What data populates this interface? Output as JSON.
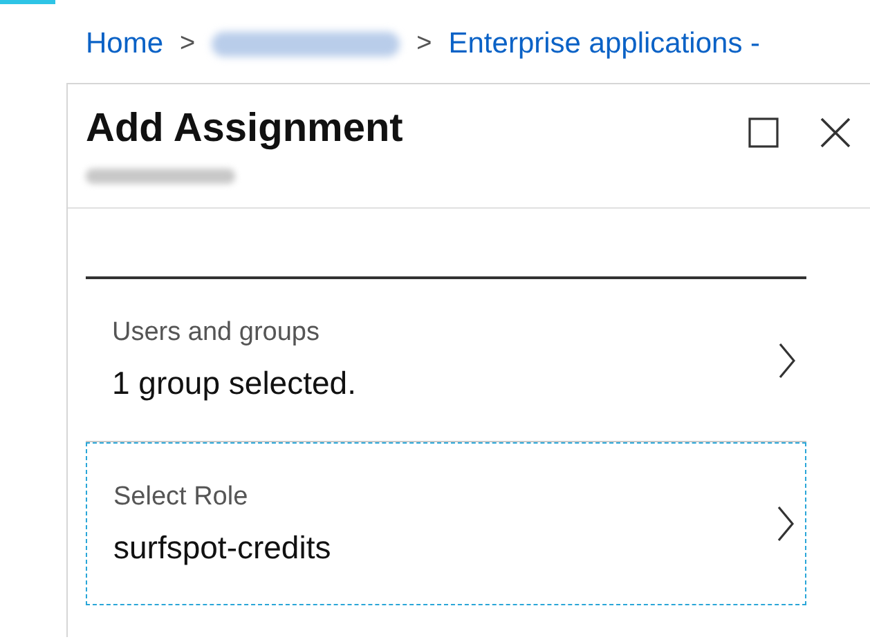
{
  "breadcrumb": {
    "separator": ">",
    "items": [
      {
        "kind": "link",
        "label": "Home"
      },
      {
        "kind": "blurred"
      },
      {
        "kind": "link",
        "label": "Enterprise applications -"
      }
    ]
  },
  "blade": {
    "title": "Add Assignment",
    "subtitle_blurred": true
  },
  "items": [
    {
      "label": "Users and groups",
      "value": "1 group selected.",
      "focused": false
    },
    {
      "label": "Select Role",
      "value": "surfspot-credits",
      "focused": true
    }
  ]
}
